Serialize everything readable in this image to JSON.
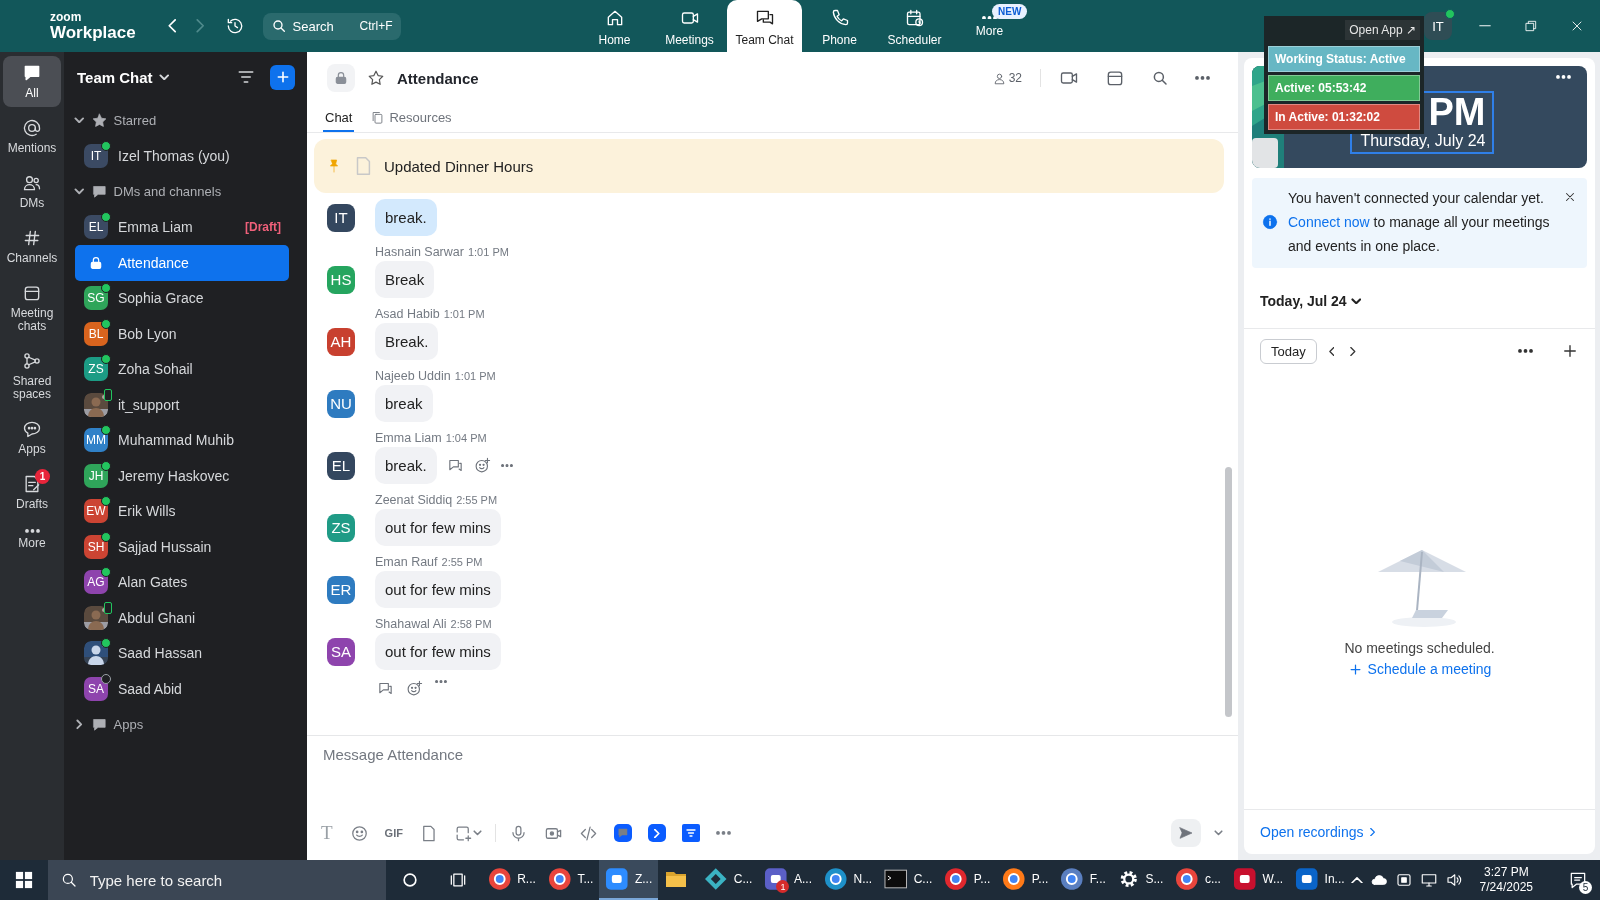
{
  "top_bar": {
    "logo": {
      "line1": "zoom",
      "line2": "Workplace"
    },
    "search": {
      "placeholder": "Search",
      "shortcut": "Ctrl+F"
    },
    "tabs": [
      {
        "label": "Home",
        "kind": "home",
        "selected": false
      },
      {
        "label": "Meetings",
        "kind": "video",
        "selected": false
      },
      {
        "label": "Team Chat",
        "kind": "chat",
        "selected": true
      },
      {
        "label": "Phone",
        "kind": "phone",
        "selected": false
      },
      {
        "label": "Scheduler",
        "kind": "scheduler",
        "selected": false
      },
      {
        "label": "More",
        "kind": "dots",
        "selected": false,
        "badge": "NEW"
      }
    ],
    "account": {
      "initials": "IT",
      "online": true
    }
  },
  "status_widget": {
    "open_app": "Open App ↗",
    "rows": [
      {
        "text": "Working Status: Active",
        "color": "#67b7c4"
      },
      {
        "text": "Active: 05:53:42",
        "color": "#3fae5d"
      },
      {
        "text": "In Active: 01:32:02",
        "color": "#cf4b3f"
      }
    ]
  },
  "rail": [
    {
      "label": "All",
      "kind": "all",
      "selected": true
    },
    {
      "label": "Mentions",
      "kind": "at",
      "selected": false
    },
    {
      "label": "DMs",
      "kind": "people",
      "selected": false
    },
    {
      "label": "Channels",
      "kind": "hash",
      "selected": false
    },
    {
      "label": "Meeting chats",
      "kind": "calendar",
      "selected": false
    },
    {
      "label": "Shared spaces",
      "kind": "share",
      "selected": false
    },
    {
      "label": "Apps",
      "kind": "speech",
      "selected": false
    },
    {
      "label": "Drafts",
      "kind": "note",
      "selected": false,
      "badge": "1"
    },
    {
      "label": "More",
      "kind": "dots",
      "selected": false
    }
  ],
  "sidebar": {
    "title": "Team Chat",
    "sections": [
      {
        "label": "Starred",
        "kind": "star",
        "expanded": true,
        "items": [
          {
            "name": "Izel Thomas (you)",
            "kind": "initials",
            "initials": "IT",
            "color": "#3b4a63",
            "online": true,
            "on_mobile": false,
            "selected": false
          }
        ]
      },
      {
        "label": "DMs and channels",
        "kind": "chat",
        "expanded": true,
        "items": [
          {
            "name": "Emma Liam",
            "kind": "initials",
            "initials": "EL",
            "color": "#3b4a63",
            "online": true,
            "on_mobile": false,
            "selected": false,
            "draft": "[Draft]"
          },
          {
            "name": "Attendance",
            "kind": "channel",
            "selected": true
          },
          {
            "name": "Sophia Grace",
            "kind": "initials",
            "initials": "SG",
            "color": "#2fa55a",
            "online": true,
            "on_mobile": false,
            "selected": false
          },
          {
            "name": "Bob Lyon",
            "kind": "initials",
            "initials": "BL",
            "color": "#d9641e",
            "online": true,
            "on_mobile": false,
            "selected": false
          },
          {
            "name": "Zoha Sohail",
            "kind": "initials",
            "initials": "ZS",
            "color": "#1c9c85",
            "online": true,
            "on_mobile": false,
            "selected": false
          },
          {
            "name": "it_support",
            "kind": "picture",
            "online": false,
            "on_mobile": true,
            "selected": false
          },
          {
            "name": "Muhammad Muhib",
            "kind": "initials",
            "initials": "MM",
            "color": "#3081c8",
            "online": true,
            "on_mobile": false,
            "selected": false
          },
          {
            "name": "Jeremy Haskovec",
            "kind": "initials",
            "initials": "JH",
            "color": "#2fa55a",
            "online": true,
            "on_mobile": false,
            "selected": false
          },
          {
            "name": "Erik Wills",
            "kind": "initials",
            "initials": "EW",
            "color": "#cc4433",
            "online": true,
            "on_mobile": false,
            "selected": false
          },
          {
            "name": "Sajjad Hussain",
            "kind": "initials",
            "initials": "SH",
            "color": "#cc4433",
            "online": true,
            "on_mobile": false,
            "selected": false
          },
          {
            "name": "Alan Gates",
            "kind": "initials",
            "initials": "AG",
            "color": "#8e44ad",
            "online": true,
            "on_mobile": false,
            "selected": false
          },
          {
            "name": "Abdul Ghani",
            "kind": "picture",
            "online": false,
            "on_mobile": true,
            "selected": false
          },
          {
            "name": "Saad Hassan",
            "kind": "picture",
            "online": true,
            "on_mobile": false,
            "selected": false
          },
          {
            "name": "Saad Abid",
            "kind": "initials",
            "initials": "SA",
            "color": "#8e44ad",
            "online": false,
            "on_mobile": false,
            "selected": false
          }
        ]
      },
      {
        "label": "Apps",
        "kind": "chat",
        "expanded": false
      }
    ]
  },
  "channel": {
    "name": "Attendance",
    "member_count": "32",
    "tabs": [
      {
        "label": "Chat",
        "selected": true
      },
      {
        "label": "Resources",
        "selected": false
      }
    ],
    "pinned": "Updated Dinner Hours",
    "messages": [
      {
        "kind": "plain",
        "initials": "IT",
        "color": "#34475f",
        "text": "break.",
        "self": true
      },
      {
        "kind": "plain",
        "initials": "HS",
        "color": "#25a55f",
        "name": "Hasnain Sarwar",
        "time": "1:01 PM",
        "text": "Break",
        "self": false
      },
      {
        "kind": "plain",
        "initials": "AH",
        "color": "#c8402f",
        "name": "Asad Habib",
        "time": "1:01 PM",
        "text": "Break.",
        "self": false
      },
      {
        "kind": "plain",
        "initials": "NU",
        "color": "#2e7bc0",
        "name": "Najeeb Uddin",
        "time": "1:01 PM",
        "text": "break",
        "self": false
      },
      {
        "kind": "hovered",
        "initials": "EL",
        "color": "#34475f",
        "name": "Emma Liam",
        "time": "1:04 PM",
        "text": "break.",
        "self": false
      },
      {
        "kind": "plain",
        "initials": "ZS",
        "color": "#1f9b86",
        "name": "Zeenat Siddiq",
        "time": "2:55 PM",
        "text": "out for few mins",
        "self": false
      },
      {
        "kind": "plain",
        "initials": "ER",
        "color": "#2e7bc0",
        "name": "Eman Rauf",
        "time": "2:55 PM",
        "text": "out for few mins",
        "self": false
      },
      {
        "kind": "last",
        "initials": "SA",
        "color": "#8e44ad",
        "name": "Shahawal Ali",
        "time": "2:58 PM",
        "text": "out for few mins",
        "self": false
      }
    ],
    "composer": {
      "placeholder": "Message Attendance",
      "format": "T",
      "gif": "GIF"
    }
  },
  "calendar": {
    "clock": {
      "time": "PM",
      "date": "Thursday, July 24"
    },
    "notice": {
      "before": "You haven't connected your calendar yet.",
      "link": "Connect now",
      "after": "to manage all your meetings and events in one place."
    },
    "day": "Today, Jul 24",
    "today_button": "Today",
    "empty": "No meetings scheduled.",
    "schedule": "Schedule a meeting",
    "recordings": "Open recordings"
  },
  "taskbar": {
    "search_placeholder": "Type here to search",
    "apps": [
      {
        "label": "R...",
        "kind": "round",
        "color": "#e8453c",
        "active": false
      },
      {
        "label": "T...",
        "kind": "round",
        "color": "#e8453c",
        "active": false
      },
      {
        "label": "Z...",
        "kind": "square",
        "color": "#2d8cff",
        "active": true
      },
      {
        "kind": "folder",
        "color": "#f5c04a",
        "active": false
      },
      {
        "label": "C...",
        "kind": "diamond",
        "color": "#3bb3c3",
        "active": false
      },
      {
        "label": "A...",
        "kind": "square",
        "color": "#5b5fc7",
        "active": false,
        "badge": "1"
      },
      {
        "label": "N...",
        "kind": "round",
        "color": "#1e90c8",
        "active": false
      },
      {
        "label": "C...",
        "kind": "terminal",
        "color": "#0c0c0c",
        "active": false
      },
      {
        "label": "P...",
        "kind": "round",
        "color": "#e0282e",
        "active": false
      },
      {
        "label": "P...",
        "kind": "round",
        "color": "#ff7a18",
        "active": false
      },
      {
        "label": "F...",
        "kind": "round",
        "color": "#5a7fc0",
        "active": false
      },
      {
        "label": "S...",
        "kind": "gear",
        "color": "#ffffff",
        "active": false
      },
      {
        "label": "c...",
        "kind": "round",
        "color": "#e8453c",
        "active": false
      },
      {
        "label": "W...",
        "kind": "square",
        "color": "#c8102e",
        "active": false
      },
      {
        "label": "In...",
        "kind": "square",
        "color": "#0a64c8",
        "active": false
      }
    ],
    "time": "3:27 PM",
    "date": "7/24/2025",
    "notifications": "5"
  }
}
